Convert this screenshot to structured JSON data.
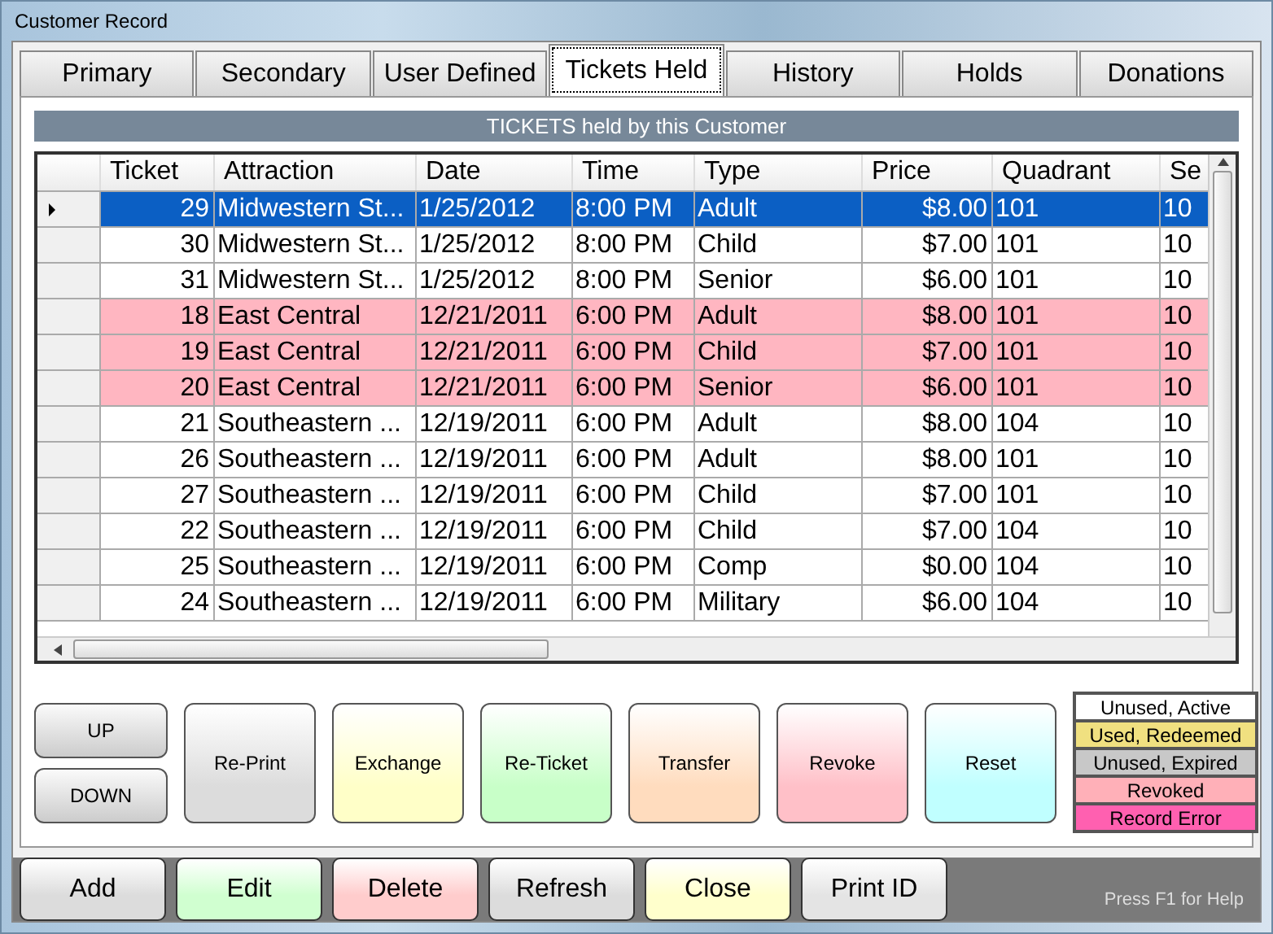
{
  "window": {
    "title": "Customer Record"
  },
  "tabs": [
    {
      "label": "Primary",
      "selected": false
    },
    {
      "label": "Secondary",
      "selected": false
    },
    {
      "label": "User Defined",
      "selected": false
    },
    {
      "label": "Tickets Held",
      "selected": true
    },
    {
      "label": "History",
      "selected": false
    },
    {
      "label": "Holds",
      "selected": false
    },
    {
      "label": "Donations",
      "selected": false
    }
  ],
  "grid": {
    "title": "TICKETS held by this Customer",
    "columns": [
      "Ticket",
      "Attraction",
      "Date",
      "Time",
      "Type",
      "Price",
      "Quadrant",
      "Se"
    ],
    "rows": [
      {
        "selected": true,
        "kind": "active",
        "cells": [
          "29",
          "Midwestern St...",
          "1/25/2012",
          "8:00 PM",
          "Adult",
          "$8.00",
          "101",
          "10"
        ]
      },
      {
        "selected": false,
        "kind": "active",
        "cells": [
          "30",
          "Midwestern St...",
          "1/25/2012",
          "8:00 PM",
          "Child",
          "$7.00",
          "101",
          "10"
        ]
      },
      {
        "selected": false,
        "kind": "active",
        "cells": [
          "31",
          "Midwestern St...",
          "1/25/2012",
          "8:00 PM",
          "Senior",
          "$6.00",
          "101",
          "10"
        ]
      },
      {
        "selected": false,
        "kind": "revoked",
        "cells": [
          "18",
          "East Central",
          "12/21/2011",
          "6:00 PM",
          "Adult",
          "$8.00",
          "101",
          "10"
        ]
      },
      {
        "selected": false,
        "kind": "revoked",
        "cells": [
          "19",
          "East Central",
          "12/21/2011",
          "6:00 PM",
          "Child",
          "$7.00",
          "101",
          "10"
        ]
      },
      {
        "selected": false,
        "kind": "revoked",
        "cells": [
          "20",
          "East Central",
          "12/21/2011",
          "6:00 PM",
          "Senior",
          "$6.00",
          "101",
          "10"
        ]
      },
      {
        "selected": false,
        "kind": "active",
        "cells": [
          "21",
          "Southeastern ...",
          "12/19/2011",
          "6:00 PM",
          "Adult",
          "$8.00",
          "104",
          "10"
        ]
      },
      {
        "selected": false,
        "kind": "active",
        "cells": [
          "26",
          "Southeastern ...",
          "12/19/2011",
          "6:00 PM",
          "Adult",
          "$8.00",
          "101",
          "10"
        ]
      },
      {
        "selected": false,
        "kind": "active",
        "cells": [
          "27",
          "Southeastern ...",
          "12/19/2011",
          "6:00 PM",
          "Child",
          "$7.00",
          "101",
          "10"
        ]
      },
      {
        "selected": false,
        "kind": "active",
        "cells": [
          "22",
          "Southeastern ...",
          "12/19/2011",
          "6:00 PM",
          "Child",
          "$7.00",
          "104",
          "10"
        ]
      },
      {
        "selected": false,
        "kind": "active",
        "cells": [
          "25",
          "Southeastern ...",
          "12/19/2011",
          "6:00 PM",
          "Comp",
          "$0.00",
          "104",
          "10"
        ]
      },
      {
        "selected": false,
        "kind": "active",
        "cells": [
          "24",
          "Southeastern ...",
          "12/19/2011",
          "6:00 PM",
          "Military",
          "$6.00",
          "104",
          "10"
        ]
      }
    ]
  },
  "nav_buttons": [
    "UP",
    "DOWN"
  ],
  "action_buttons": [
    {
      "label": "Re-Print",
      "color": "#dcdcdc"
    },
    {
      "label": "Exchange",
      "color": "#ffffc8"
    },
    {
      "label": "Re-Ticket",
      "color": "#c8ffc8"
    },
    {
      "label": "Transfer",
      "color": "#ffdcbe"
    },
    {
      "label": "Revoke",
      "color": "#ffc0c8"
    },
    {
      "label": "Reset",
      "color": "#c0ffff"
    }
  ],
  "legend": [
    {
      "label": "Unused, Active",
      "color": "#ffffff"
    },
    {
      "label": "Used, Redeemed",
      "color": "#f0e080"
    },
    {
      "label": "Unused, Expired",
      "color": "#c8c8c8"
    },
    {
      "label": "Revoked",
      "color": "#ffb0b8"
    },
    {
      "label": "Record Error",
      "color": "#ff60b0"
    }
  ],
  "bottom_buttons": [
    {
      "label": "Add",
      "color": "#dcdcdc"
    },
    {
      "label": "Edit",
      "color": "#d0ffd0"
    },
    {
      "label": "Delete",
      "color": "#ffcccc"
    },
    {
      "label": "Refresh",
      "color": "#dcdcdc"
    },
    {
      "label": "Close",
      "color": "#ffffcc"
    },
    {
      "label": "Print ID",
      "color": "#e4e4e4"
    }
  ],
  "help_text": "Press F1 for Help"
}
